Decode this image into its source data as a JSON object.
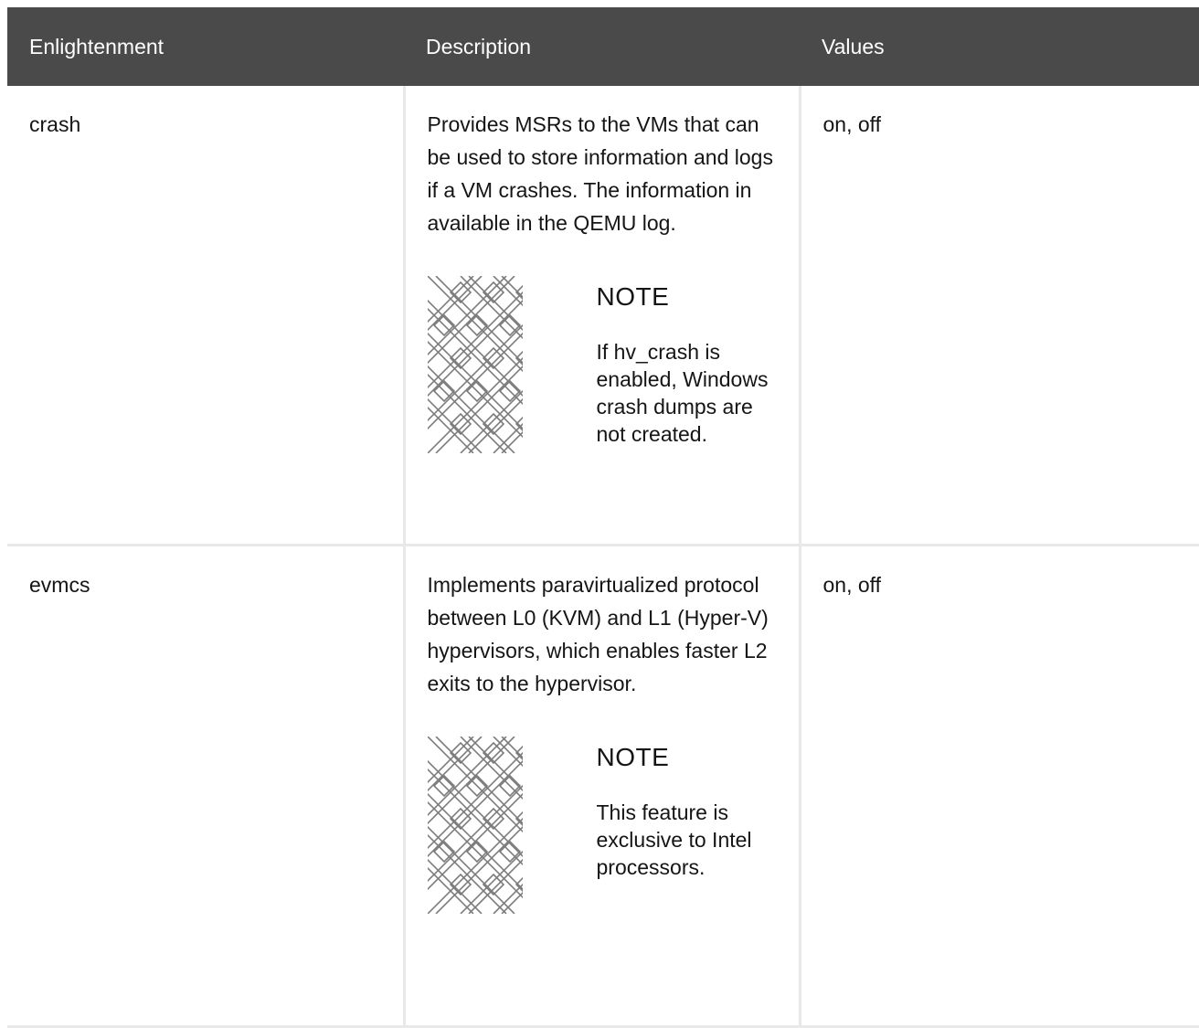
{
  "table": {
    "headers": [
      "Enlightenment",
      "Description",
      "Values"
    ],
    "rows": [
      {
        "enlightenment": "crash",
        "description": "Provides MSRs to the VMs that can be used to store information and logs if a VM crashes. The information in available in the QEMU log.",
        "note_title": "NOTE",
        "note_text": "If hv_crash is enabled, Windows crash dumps are not created.",
        "values": "on, off"
      },
      {
        "enlightenment": "evmcs",
        "description": "Implements paravirtualized protocol between L0 (KVM) and L1 (Hyper-V) hypervisors, which enables faster L2 exits to the hypervisor.",
        "note_title": "NOTE",
        "note_text": "This feature is exclusive to Intel processors.",
        "values": "on, off"
      }
    ]
  },
  "icons": {
    "note": "note-pattern-icon"
  },
  "colors": {
    "header_bg": "#4a4a4a",
    "header_text": "#ffffff",
    "border": "#e8e8e8",
    "text": "#151515"
  }
}
